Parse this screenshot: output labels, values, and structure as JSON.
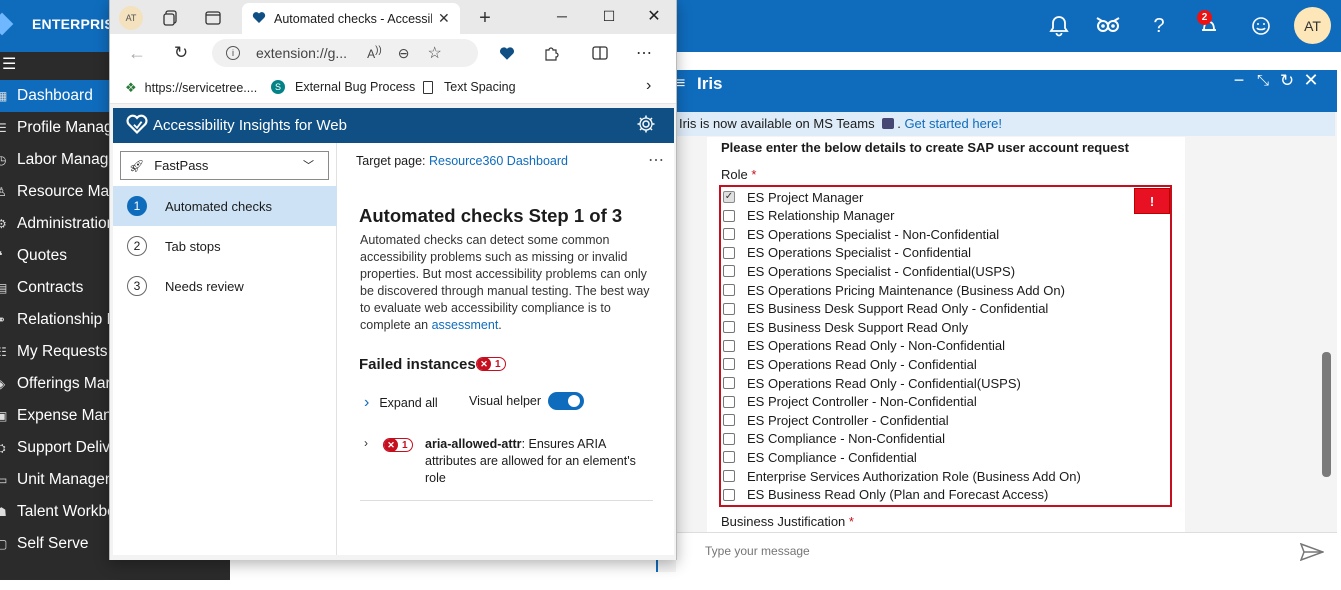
{
  "app": {
    "brand": "ENTERPRISE",
    "notif_count": "2",
    "user_initials": "AT"
  },
  "sidebar": {
    "items": [
      {
        "label": "Dashboard",
        "icon": "dashboard-icon"
      },
      {
        "label": "Profile Manag",
        "icon": "list-icon"
      },
      {
        "label": "Labor Manage",
        "icon": "clock-icon"
      },
      {
        "label": "Resource Man",
        "icon": "person-icon"
      },
      {
        "label": "Administration",
        "icon": "admin-icon"
      },
      {
        "label": "Quotes",
        "icon": "quote-icon"
      },
      {
        "label": "Contracts",
        "icon": "contract-icon"
      },
      {
        "label": "Relationship M",
        "icon": "relationship-icon"
      },
      {
        "label": "My Requests",
        "icon": "requests-icon"
      },
      {
        "label": "Offerings Mar",
        "icon": "offerings-icon"
      },
      {
        "label": "Expense Mana",
        "icon": "expense-icon"
      },
      {
        "label": "Support Deliv",
        "icon": "support-icon"
      },
      {
        "label": "Unit Managen",
        "icon": "unit-icon"
      },
      {
        "label": "Talent Workbe",
        "icon": "talent-icon"
      },
      {
        "label": "Self Serve",
        "icon": "selfserve-icon"
      }
    ]
  },
  "iris": {
    "title": "Iris",
    "banner_text": "Iris is now available on MS Teams",
    "banner_link": "Get started here!",
    "form_heading": "Please enter the below details to create SAP user account request",
    "role_label": "Role",
    "required_mark": "*",
    "error_flag": "!",
    "roles": [
      {
        "label": "ES Project Manager",
        "checked": true
      },
      {
        "label": "ES Relationship Manager",
        "checked": false
      },
      {
        "label": "ES Operations Specialist - Non-Confidential",
        "checked": false
      },
      {
        "label": "ES Operations Specialist - Confidential",
        "checked": false
      },
      {
        "label": "ES Operations Specialist - Confidential(USPS)",
        "checked": false
      },
      {
        "label": "ES Operations Pricing Maintenance (Business Add On)",
        "checked": false
      },
      {
        "label": "ES Business Desk Support Read Only - Confidential",
        "checked": false
      },
      {
        "label": "ES Business Desk Support Read Only",
        "checked": false
      },
      {
        "label": "ES Operations Read Only - Non-Confidential",
        "checked": false
      },
      {
        "label": "ES Operations Read Only - Confidential",
        "checked": false
      },
      {
        "label": "ES Operations Read Only - Confidential(USPS)",
        "checked": false
      },
      {
        "label": "ES Project Controller - Non-Confidential",
        "checked": false
      },
      {
        "label": "ES Project Controller - Confidential",
        "checked": false
      },
      {
        "label": "ES Compliance - Non-Confidential",
        "checked": false
      },
      {
        "label": "ES Compliance - Confidential",
        "checked": false
      },
      {
        "label": "Enterprise Services Authorization Role (Business Add On)",
        "checked": false
      },
      {
        "label": "ES Business Read Only (Plan and Forecast Access)",
        "checked": false
      }
    ],
    "business_justification_label": "Business Justification",
    "message_placeholder": "Type your message"
  },
  "browser": {
    "profile_initials": "AT",
    "tab_title": "Automated checks - Accessib",
    "url": "extension://g...",
    "favorites": [
      {
        "label": "https://servicetree....",
        "icon": "tree-icon"
      },
      {
        "label": "External Bug Process",
        "icon": "sharepoint-icon"
      },
      {
        "label": "Text Spacing",
        "icon": "page-icon"
      }
    ]
  },
  "ai": {
    "title": "Accessibility Insights for Web",
    "mode": "FastPass",
    "steps": [
      {
        "num": "1",
        "label": "Automated checks"
      },
      {
        "num": "2",
        "label": "Tab stops"
      },
      {
        "num": "3",
        "label": "Needs review"
      }
    ],
    "target_label": "Target page:",
    "target_link": "Resource360 Dashboard",
    "heading": "Automated checks Step 1 of 3",
    "description": "Automated checks can detect some common accessibility problems such as missing or invalid properties. But most accessibility problems can only be discovered through manual testing. The best way to evaluate web accessibility compliance is to complete an",
    "description_link": "assessment",
    "failed_heading": "Failed instances",
    "failed_count": "1",
    "expand_all": "Expand all",
    "visual_helper": "Visual helper",
    "visual_helper_on": true,
    "rule_id": "aria-allowed-attr",
    "rule_desc": ": Ensures ARIA attributes are allowed for an element's role",
    "rule_count": "1"
  }
}
